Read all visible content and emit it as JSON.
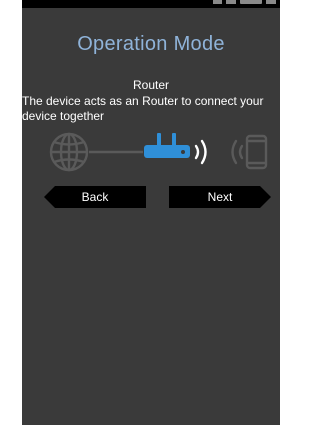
{
  "screen": {
    "title": "Operation Mode",
    "mode_name": "Router",
    "mode_description": "The device acts as an Router to connect your device together"
  },
  "diagram": {
    "icons": [
      "globe-icon",
      "router-icon",
      "wifi-waves-icon",
      "phone-signal-icon",
      "smartphone-icon"
    ],
    "router_color": "#2f8fd8",
    "icon_color": "#5a5a5a"
  },
  "buttons": {
    "back_label": "Back",
    "next_label": "Next"
  },
  "colors": {
    "background": "#3a3a3a",
    "title": "#8fb3d9",
    "button": "#000000",
    "text": "#ffffff"
  }
}
